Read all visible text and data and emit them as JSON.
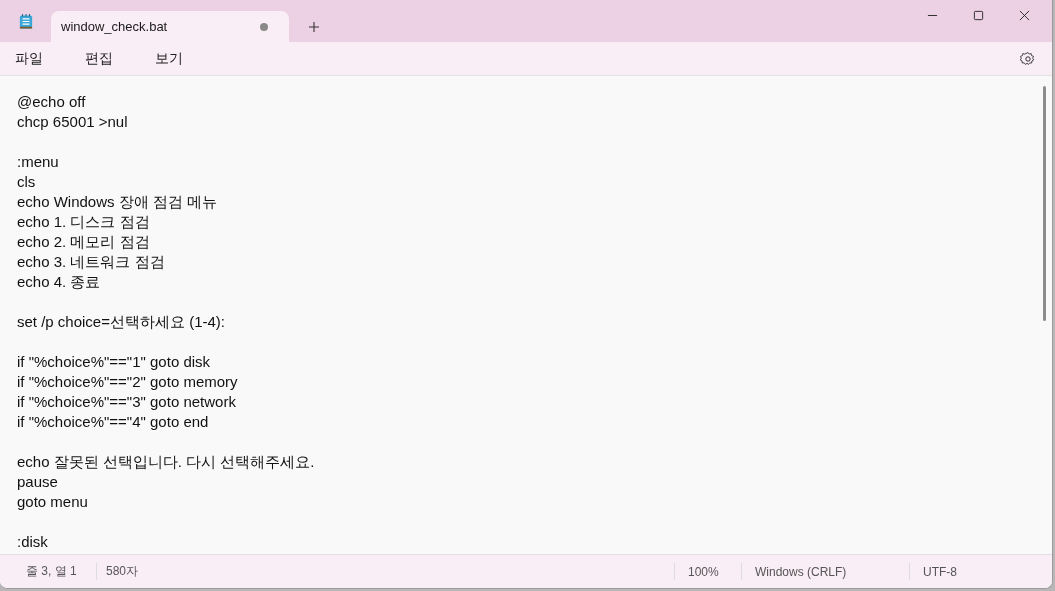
{
  "tabs": [
    {
      "title": "window_check.bat",
      "selected": true,
      "unsaved": true
    }
  ],
  "menu": [
    "파일",
    "편집",
    "보기"
  ],
  "editor": {
    "blocks": [
      [
        "@echo off",
        "chcp 65001 >nul"
      ],
      [
        ":menu",
        "cls",
        "echo Windows 장애 점검 메뉴",
        "echo 1. 디스크 점검",
        "echo 2. 메모리 점검",
        "echo 3. 네트워크 점검",
        "echo 4. 종료"
      ],
      [
        "set /p choice=선택하세요 (1-4):"
      ],
      [
        "if \"%choice%\"==\"1\" goto disk",
        "if \"%choice%\"==\"2\" goto memory",
        "if \"%choice%\"==\"3\" goto network",
        "if \"%choice%\"==\"4\" goto end"
      ],
      [
        "echo 잘못된 선택입니다. 다시 선택해주세요.",
        "pause",
        "goto menu"
      ],
      [
        ":disk"
      ]
    ]
  },
  "status_bar": {
    "position": "줄 3, 열 1",
    "characters": "580자",
    "zoom": "100%",
    "line_ending": "Windows (CRLF)",
    "encoding": "UTF-8"
  }
}
